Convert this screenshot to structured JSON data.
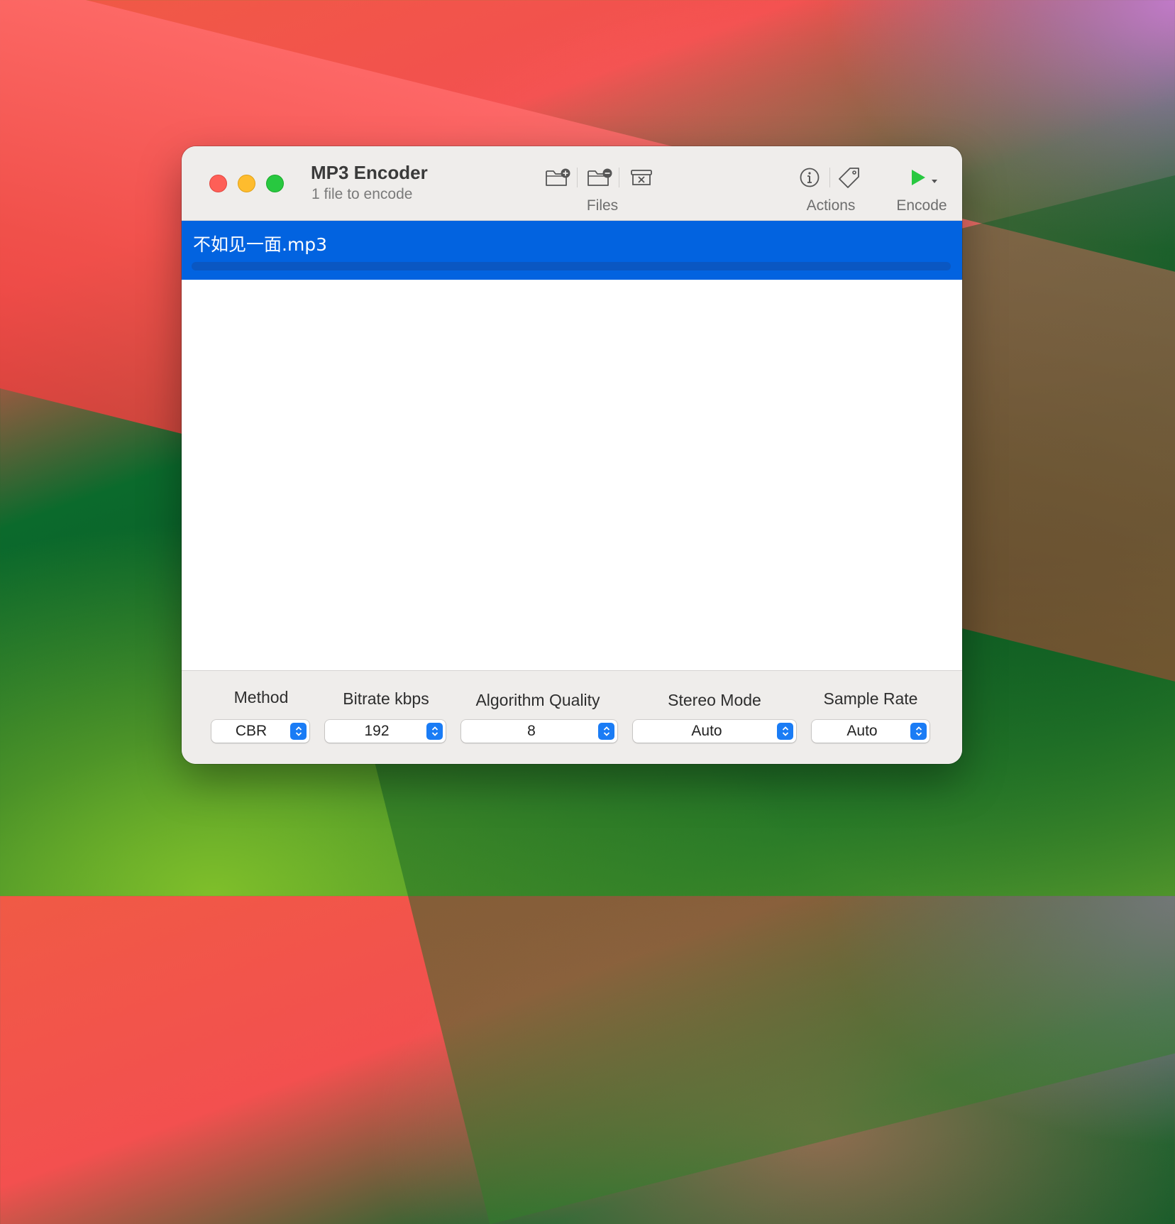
{
  "window": {
    "title": "MP3 Encoder",
    "subtitle": "1 file to encode"
  },
  "toolbar": {
    "files_label": "Files",
    "actions_label": "Actions",
    "encode_label": "Encode",
    "icons": [
      "add-folder-icon",
      "remove-folder-icon",
      "clear-archive-icon",
      "info-icon",
      "tag-icon",
      "play-icon",
      "dropdown-arrow-icon"
    ]
  },
  "files": [
    {
      "name": "不如见一面.mp3",
      "progress": 0
    }
  ],
  "settings": {
    "method": {
      "label": "Method",
      "value": "CBR"
    },
    "bitrate": {
      "label": "Bitrate kbps",
      "value": "192"
    },
    "quality": {
      "label": "Algorithm Quality",
      "value": "8"
    },
    "stereo": {
      "label": "Stereo Mode",
      "value": "Auto"
    },
    "sample_rate": {
      "label": "Sample Rate",
      "value": "Auto"
    }
  },
  "colors": {
    "selection": "#0263e0",
    "accent": "#1a7cf5",
    "play": "#28c840",
    "close": "#fe5f57",
    "minimize": "#febc2e",
    "zoom": "#28c840"
  }
}
